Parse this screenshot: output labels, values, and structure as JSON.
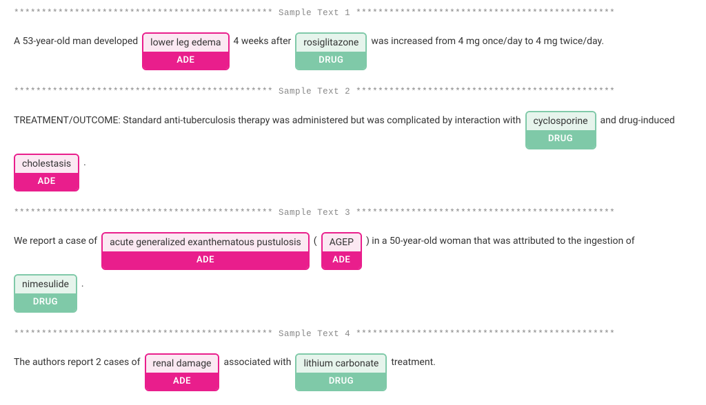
{
  "labels": {
    "ade": "ADE",
    "drug": "DRUG"
  },
  "samples": [
    {
      "header": "*********************************************** Sample Text 1 ***********************************************",
      "tokens": [
        {
          "type": "text",
          "text": "A 53-year-old man developed"
        },
        {
          "type": "entity",
          "label": "ade",
          "text": "lower leg edema"
        },
        {
          "type": "text",
          "text": "4 weeks after"
        },
        {
          "type": "entity",
          "label": "drug",
          "text": "rosiglitazone"
        },
        {
          "type": "text",
          "text": "was increased from 4 mg once/day to 4 mg twice/day."
        }
      ]
    },
    {
      "header": "*********************************************** Sample Text 2 ***********************************************",
      "tokens": [
        {
          "type": "text",
          "text": "TREATMENT/OUTCOME: Standard anti-tuberculosis therapy was administered but was complicated by interaction with"
        },
        {
          "type": "entity",
          "label": "drug",
          "text": "cyclosporine"
        },
        {
          "type": "text",
          "text": "and drug-induced"
        },
        {
          "type": "entity",
          "label": "ade",
          "text": "cholestasis"
        },
        {
          "type": "text",
          "text": "."
        }
      ]
    },
    {
      "header": "*********************************************** Sample Text 3 ***********************************************",
      "tokens": [
        {
          "type": "text",
          "text": "We report a case of"
        },
        {
          "type": "entity",
          "label": "ade",
          "text": "acute generalized exanthematous pustulosis"
        },
        {
          "type": "text",
          "text": "("
        },
        {
          "type": "entity",
          "label": "ade",
          "text": "AGEP"
        },
        {
          "type": "text",
          "text": ") in a 50-year-old woman that was attributed to the ingestion of"
        },
        {
          "type": "entity",
          "label": "drug",
          "text": "nimesulide"
        },
        {
          "type": "text",
          "text": "."
        }
      ]
    },
    {
      "header": "*********************************************** Sample Text 4 ***********************************************",
      "tokens": [
        {
          "type": "text",
          "text": "The authors report 2 cases of"
        },
        {
          "type": "entity",
          "label": "ade",
          "text": "renal damage"
        },
        {
          "type": "text",
          "text": "associated with"
        },
        {
          "type": "entity",
          "label": "drug",
          "text": "lithium carbonate"
        },
        {
          "type": "text",
          "text": "treatment."
        }
      ]
    }
  ]
}
